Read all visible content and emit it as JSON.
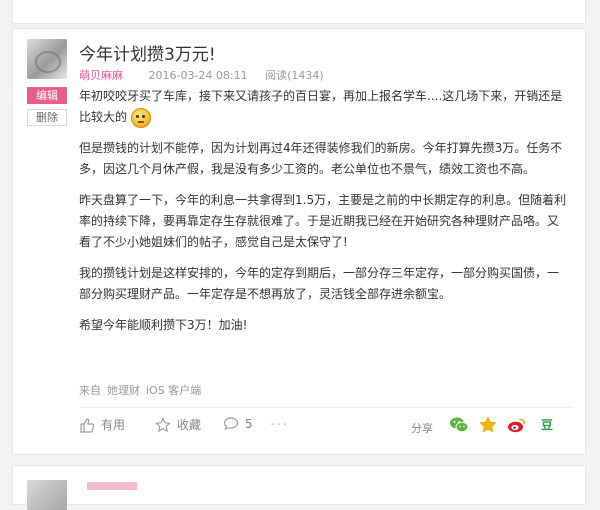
{
  "post": {
    "title": "今年计划攒3万元!",
    "author": "萌贝麻麻",
    "date": "2016-03-24 08:11",
    "reads": "阅读(1434)",
    "paragraphs": [
      "年初咬咬牙买了车库，接下来又请孩子的百日宴，再加上报名学车....这几场下来，开销还是比较大的",
      "但是攒钱的计划不能停，因为计划再过4年还得装修我们的新房。今年打算先攒3万。任务不多，因这几个月休产假，我是没有多少工资的。老公单位也不景气，绩效工资也不高。",
      "昨天盘算了一下，今年的利息一共拿得到1.5万，主要是之前的中长期定存的利息。但随着利率的持续下降，要再靠定存生存就很难了。于是近期我已经在开始研究各种理财产品咯。又看了不少小她姐妹们的帖子，感觉自己是太保守了!",
      "我的攒钱计划是这样安排的，今年的定存到期后，一部分存三年定存，一部分购买国债，一部分购买理财产品。一年定存是不想再放了，灵活钱全部存进余额宝。",
      "希望今年能顺利攒下3万！加油!"
    ],
    "source": {
      "prefix": "来自",
      "app": "她理财",
      "platform": "iOS 客户端"
    }
  },
  "side_buttons": {
    "edit": "编辑",
    "delete": "删除"
  },
  "actions": {
    "like": "有用",
    "favorite": "收藏",
    "comments": "5",
    "more": "···",
    "share_label": "分享",
    "douban": "豆"
  },
  "icons": {
    "like": "thumbs-up-icon",
    "favorite": "star-outline-icon",
    "comment": "comment-bubble-icon",
    "wechat": "wechat-icon",
    "qzone": "qzone-star-icon",
    "weibo": "weibo-icon",
    "emoji": "shy-face-emoji-icon"
  },
  "colors": {
    "brand_pink": "#e85d8c",
    "wechat_green": "#5bb53c",
    "qzone_yellow": "#f5b800",
    "weibo_red": "#e6162d",
    "douban_green": "#2ca34a"
  }
}
